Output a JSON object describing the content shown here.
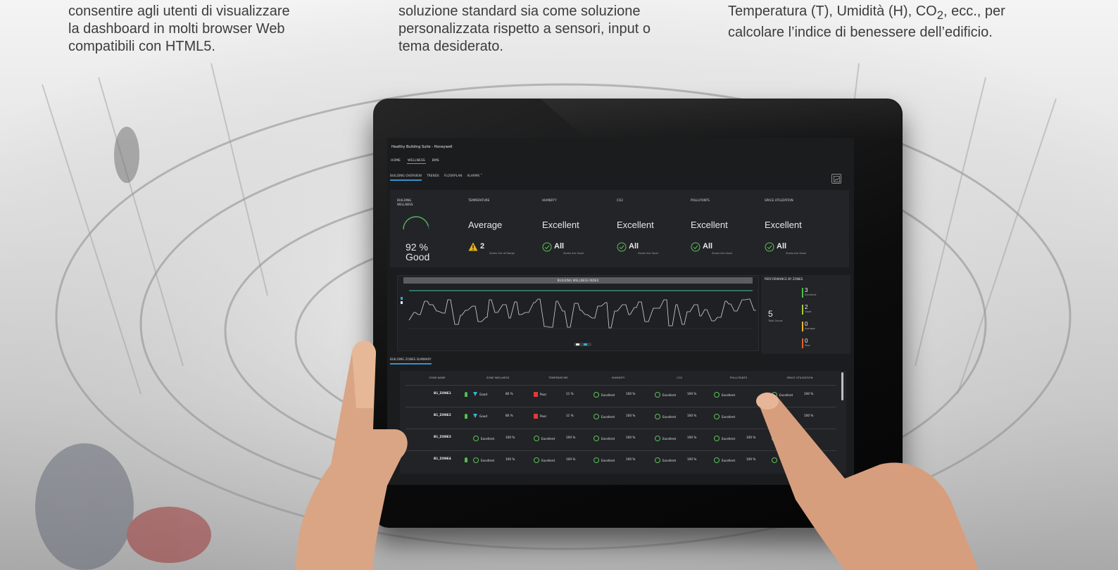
{
  "captions": [
    {
      "lines": "consentire agli utenti di visualizzare\nla dashboard in molti browser Web\ncompatibili con HTML5."
    },
    {
      "lines": "soluzione standard sia come soluzione\npersonalizzata rispetto a sensori, input o\ntema desiderato."
    },
    {
      "line1_pre": "Temperatura (T), Umidità (H), CO",
      "sub": "2",
      "line1_post": ", ecc., per",
      "line2": "calcolare l’indice di benessere dell’edificio."
    }
  ],
  "app": {
    "title": "Healthy Building Suite - Honeywell",
    "nav_top": [
      "HOME",
      "WELLNESS",
      "BMS"
    ],
    "nav_sub": [
      "BUILDING OVERVIEW",
      "TRENDS",
      "FLOORPLAN",
      "ALARMS"
    ]
  },
  "kpis": {
    "wellness": {
      "title": "BUILDING\nWELLNESS",
      "pct": "92 %",
      "status": "Good",
      "gauge_fraction": 0.92
    },
    "cards": [
      {
        "title": "TEMPERATURE",
        "status": "Average",
        "count": "2",
        "note": "Zones Out of Range",
        "icon": "warning-icon"
      },
      {
        "title": "HUMIDITY",
        "status": "Excellent",
        "count": "All",
        "note": "Zones Are Good",
        "icon": "check-circle-icon"
      },
      {
        "title": "CO2",
        "status": "Excellent",
        "count": "All",
        "note": "Zones Are Good",
        "icon": "check-circle-icon"
      },
      {
        "title": "POLLUTANTS",
        "status": "Excellent",
        "count": "All",
        "note": "Zones Are Good",
        "icon": "check-circle-icon"
      },
      {
        "title": "SPACE UTILIZATION",
        "status": "Excellent",
        "count": "All",
        "note": "Zones Are Good",
        "icon": "check-circle-icon"
      }
    ]
  },
  "chart": {
    "title": "BUILDING WELLNESS INDEX",
    "legend": [
      "",
      ""
    ]
  },
  "performance": {
    "title": "PERFORMANCE BY ZONES",
    "total": "5",
    "total_label": "Total Zones",
    "rows": [
      {
        "count": "3",
        "label": "Excellent",
        "color": "#4cbf4c"
      },
      {
        "count": "2",
        "label": "Good",
        "color": "#9fce3a"
      },
      {
        "count": "0",
        "label": "Average",
        "color": "#e8b830"
      },
      {
        "count": "0",
        "label": "Poor",
        "color": "#e0632d"
      }
    ]
  },
  "zones": {
    "tab": "BUILDING ZONES SUMMARY",
    "headers": [
      "ZONE NAME",
      "ZONE WELLNESS",
      "TEMPERATURE",
      "HUMIDITY",
      "CO2",
      "POLLUTANTS",
      "SPACE UTILIZATION"
    ],
    "rows": [
      {
        "name": "B1_ZONE1",
        "cells": [
          [
            "Good",
            "80 %"
          ],
          [
            "Poor",
            "11 %"
          ],
          [
            "Excellent",
            "100 %"
          ],
          [
            "Excellent",
            "100 %"
          ],
          [
            "Excellent",
            ""
          ],
          [
            "Excellent",
            "100 %"
          ]
        ]
      },
      {
        "name": "B1_ZONE2",
        "cells": [
          [
            "Good",
            "80 %"
          ],
          [
            "Poor",
            "11 %"
          ],
          [
            "Excellent",
            "100 %"
          ],
          [
            "Excellent",
            "100 %"
          ],
          [
            "Excellent",
            ""
          ],
          [
            "",
            "100 %"
          ]
        ]
      },
      {
        "name": "B1_ZONE3",
        "cells": [
          [
            "Excellent",
            "100 %"
          ],
          [
            "Excellent",
            "100 %"
          ],
          [
            "Excellent",
            "100 %"
          ],
          [
            "Excellent",
            "100 %"
          ],
          [
            "Excellent",
            "100 %"
          ],
          [
            "",
            ""
          ]
        ]
      },
      {
        "name": "B1_ZONE4",
        "cells": [
          [
            "Excellent",
            "100 %"
          ],
          [
            "Excellent",
            "100 %"
          ],
          [
            "Excellent",
            "100 %"
          ],
          [
            "Excellent",
            "100 %"
          ],
          [
            "Excellent",
            "100 %"
          ],
          [
            "",
            ""
          ]
        ]
      }
    ]
  },
  "colors": {
    "accent": "#3a8fcb",
    "ok": "#59c15a",
    "poor": "#e03a3a",
    "good": "#2fb8d2"
  }
}
